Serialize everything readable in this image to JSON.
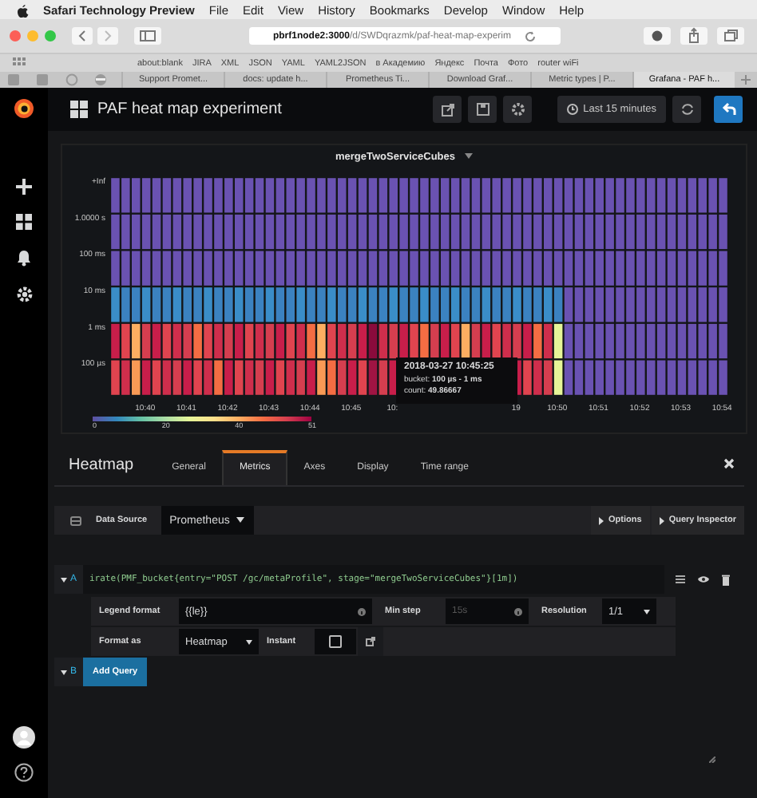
{
  "menubar": {
    "app": "Safari Technology Preview",
    "items": [
      "File",
      "Edit",
      "View",
      "History",
      "Bookmarks",
      "Develop",
      "Window",
      "Help"
    ]
  },
  "browser": {
    "url_host": "pbrf1node2:3000",
    "url_path": "/d/SWDqrazmk/paf-heat-map-experim",
    "bookmarks": [
      "about:blank",
      "JIRA",
      "XML",
      "JSON",
      "YAML",
      "YAML2JSON",
      "в Академию",
      "Яндекс",
      "Почта",
      "Фото",
      "router wiFi"
    ],
    "tabs": [
      {
        "label": "Support Promet...",
        "selected": false
      },
      {
        "label": "docs: update h...",
        "selected": false
      },
      {
        "label": "Prometheus Ti...",
        "selected": false
      },
      {
        "label": "Download Graf...",
        "selected": false
      },
      {
        "label": "Metric types | P...",
        "selected": false
      },
      {
        "label": "Grafana - PAF h...",
        "selected": true
      }
    ]
  },
  "navbar": {
    "title": "PAF heat map experiment",
    "time_range": "Last 15 minutes"
  },
  "panel": {
    "title": "mergeTwoServiceCubes",
    "y_labels": [
      "+Inf",
      "1.0000 s",
      "100 ms",
      "10 ms",
      "1 ms",
      "100 µs"
    ],
    "x_labels": [
      "10:40",
      "10:41",
      "10:42",
      "10:43",
      "10:44",
      "10:45",
      "10:"
    ],
    "x_labels_after_tooltip": [
      "19",
      "10:50",
      "10:51",
      "10:52",
      "10:53",
      "10:54"
    ],
    "tooltip": {
      "time": "2018-03-27 10:45:25",
      "bucket": "bucket: **100 µs - 1 ms**",
      "count": "count: **49.86667**"
    },
    "legend_labels": [
      "0",
      "20",
      "40",
      "51"
    ]
  },
  "editor": {
    "title": "Heatmap",
    "tabs": [
      {
        "label": "General",
        "selected": false
      },
      {
        "label": "Metrics",
        "selected": true
      },
      {
        "label": "Axes",
        "selected": false
      },
      {
        "label": "Display",
        "selected": false
      },
      {
        "label": "Time range",
        "selected": false
      }
    ],
    "data_source": {
      "label": "Data Source",
      "value": "Prometheus"
    },
    "options_label": "Options",
    "inspector_label": "Query Inspector",
    "query": {
      "letter": "A",
      "expr": "irate(PMF_bucket{entry=\"POST /gc/metaProfile\", stage=\"mergeTwoServiceCubes\"}[1m])"
    },
    "legend_format": {
      "label": "Legend format",
      "value": "{{le}}"
    },
    "min_step": {
      "label": "Min step",
      "placeholder": "15s"
    },
    "resolution": {
      "label": "Resolution",
      "value": "1/1"
    },
    "format_as": {
      "label": "Format as",
      "value": "Heatmap"
    },
    "instant": {
      "label": "Instant",
      "checked": false
    },
    "next_query": {
      "letter": "B",
      "button": "Add Query"
    }
  }
}
